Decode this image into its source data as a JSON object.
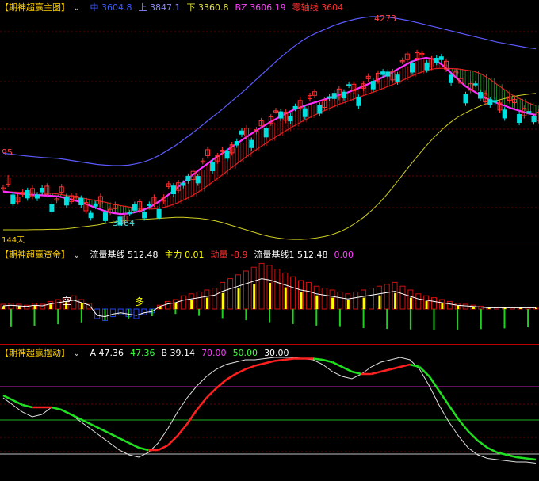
{
  "panel1": {
    "title": "【期神超赢主图】",
    "indicators": [
      {
        "label": "中",
        "value": "3604.8",
        "color": "#3b5bff"
      },
      {
        "label": "上",
        "value": "3847.1",
        "color": "#8a8aff"
      },
      {
        "label": "下",
        "value": "3360.8",
        "color": "#e0e040"
      },
      {
        "label": "BZ",
        "value": "3606.19",
        "color": "#ff40ff"
      },
      {
        "label": "零轴线",
        "value": "3604",
        "color": "#ff3030"
      }
    ],
    "annotations": {
      "high": "4273",
      "low": "3464",
      "left": "95",
      "days": "144天"
    }
  },
  "panel2": {
    "title": "【期神超赢资金】",
    "indicators": [
      {
        "label": "流量基线",
        "value": "512.48",
        "color": "#ffffff"
      },
      {
        "label": "主力",
        "value": "0.01",
        "color": "#ffff00"
      },
      {
        "label": "动量",
        "value": "-8.9",
        "color": "#ff3030"
      },
      {
        "label": "流量基线1",
        "value": "512.48",
        "color": "#ffffff"
      },
      {
        "label": "",
        "value": "0.00",
        "color": "#ff40ff"
      }
    ],
    "annotations": {
      "kong": "空",
      "duo": "多"
    }
  },
  "panel3": {
    "title": "【期神超赢摆动】",
    "indicators": [
      {
        "label": "A",
        "value": "47.36",
        "color": "#ffffff"
      },
      {
        "label": "",
        "value": "47.36",
        "color": "#40ff40"
      },
      {
        "label": "B",
        "value": "39.14",
        "color": "#ffffff"
      },
      {
        "label": "",
        "value": "70.00",
        "color": "#ff40ff"
      },
      {
        "label": "",
        "value": "50.00",
        "color": "#40ff40"
      },
      {
        "label": "",
        "value": "30.00",
        "color": "#ffffff"
      }
    ]
  },
  "chart_data": [
    {
      "type": "candlestick",
      "title": "【期神超赢主图】",
      "ylim": [
        3400,
        4300
      ],
      "series": [
        {
          "name": "中",
          "values": [
            3560,
            3556,
            3552,
            3548,
            3546,
            3544,
            3542,
            3540,
            3532,
            3524,
            3514,
            3502,
            3490,
            3478,
            3470,
            3466,
            3468,
            3474,
            3484,
            3500,
            3520,
            3544,
            3570,
            3598,
            3624,
            3650,
            3674,
            3698,
            3720,
            3742,
            3764,
            3786,
            3808,
            3828,
            3848,
            3866,
            3884,
            3900,
            3912,
            3924,
            3934,
            3944,
            3954,
            3964,
            3974,
            3986,
            4000,
            4014,
            4030,
            4046,
            4064,
            4082,
            4100,
            4112,
            4118,
            4112,
            4090,
            4060,
            4030,
            4000,
            3980,
            3960,
            3944,
            3930,
            3918,
            3906,
            3896,
            3886,
            3880
          ]
        },
        {
          "name": "上",
          "values": [
            3720,
            3716,
            3712,
            3708,
            3705,
            3702,
            3700,
            3698,
            3693,
            3688,
            3683,
            3678,
            3673,
            3670,
            3668,
            3668,
            3670,
            3676,
            3684,
            3696,
            3712,
            3732,
            3752,
            3776,
            3800,
            3826,
            3852,
            3878,
            3904,
            3932,
            3960,
            3988,
            4018,
            4048,
            4078,
            4108,
            4136,
            4162,
            4186,
            4206,
            4222,
            4236,
            4250,
            4262,
            4272,
            4280,
            4286,
            4290,
            4290,
            4288,
            4284,
            4278,
            4272,
            4264,
            4256,
            4248,
            4240,
            4232,
            4224,
            4216,
            4208,
            4200,
            4192,
            4184,
            4178,
            4172,
            4166,
            4160,
            4156
          ]
        },
        {
          "name": "下",
          "values": [
            3400,
            3400,
            3400,
            3400,
            3401,
            3401,
            3402,
            3402,
            3404,
            3408,
            3412,
            3416,
            3420,
            3426,
            3432,
            3436,
            3440,
            3442,
            3444,
            3446,
            3448,
            3450,
            3452,
            3452,
            3450,
            3448,
            3444,
            3438,
            3430,
            3420,
            3410,
            3400,
            3390,
            3380,
            3372,
            3366,
            3362,
            3360,
            3360,
            3362,
            3366,
            3372,
            3380,
            3392,
            3408,
            3428,
            3452,
            3480,
            3512,
            3548,
            3588,
            3630,
            3672,
            3712,
            3750,
            3786,
            3818,
            3846,
            3870,
            3888,
            3904,
            3918,
            3930,
            3940,
            3948,
            3956,
            3962,
            3966,
            3970
          ]
        }
      ]
    },
    {
      "type": "bar",
      "title": "【期神超赢资金】",
      "series": [
        {
          "name": "流量基线",
          "values": [
            5,
            6,
            5,
            4,
            6,
            5,
            8,
            10,
            12,
            14,
            10,
            6,
            -10,
            -12,
            -8,
            -6,
            -8,
            -10,
            -6,
            -4,
            4,
            8,
            10,
            14,
            16,
            18,
            20,
            22,
            28,
            32,
            36,
            40,
            44,
            48,
            46,
            42,
            38,
            34,
            30,
            28,
            24,
            22,
            20,
            18,
            16,
            18,
            20,
            22,
            24,
            26,
            28,
            24,
            20,
            16,
            14,
            12,
            10,
            8,
            6,
            5,
            4,
            3,
            2,
            2,
            2,
            2,
            2,
            2,
            2
          ]
        }
      ]
    },
    {
      "type": "line",
      "title": "【期神超赢摆动】",
      "ylim": [
        0,
        100
      ],
      "series": [
        {
          "name": "A",
          "values": [
            60,
            54,
            48,
            44,
            46,
            52,
            50,
            46,
            40,
            34,
            28,
            22,
            16,
            12,
            10,
            14,
            22,
            34,
            48,
            60,
            70,
            78,
            84,
            88,
            90,
            92,
            92,
            93,
            94,
            94,
            94,
            93,
            92,
            88,
            82,
            78,
            76,
            80,
            86,
            90,
            92,
            94,
            92,
            84,
            70,
            54,
            40,
            28,
            18,
            12,
            9,
            8,
            7,
            6,
            6,
            5
          ]
        },
        {
          "name": "B",
          "values": [
            62,
            58,
            54,
            52,
            52,
            52,
            50,
            46,
            42,
            38,
            34,
            30,
            26,
            22,
            18,
            16,
            16,
            20,
            28,
            38,
            50,
            60,
            68,
            75,
            80,
            84,
            87,
            89,
            91,
            92,
            93,
            93,
            93,
            92,
            90,
            86,
            82,
            80,
            80,
            82,
            84,
            86,
            88,
            86,
            78,
            66,
            54,
            42,
            32,
            24,
            18,
            14,
            12,
            10,
            9,
            8
          ]
        }
      ]
    }
  ]
}
